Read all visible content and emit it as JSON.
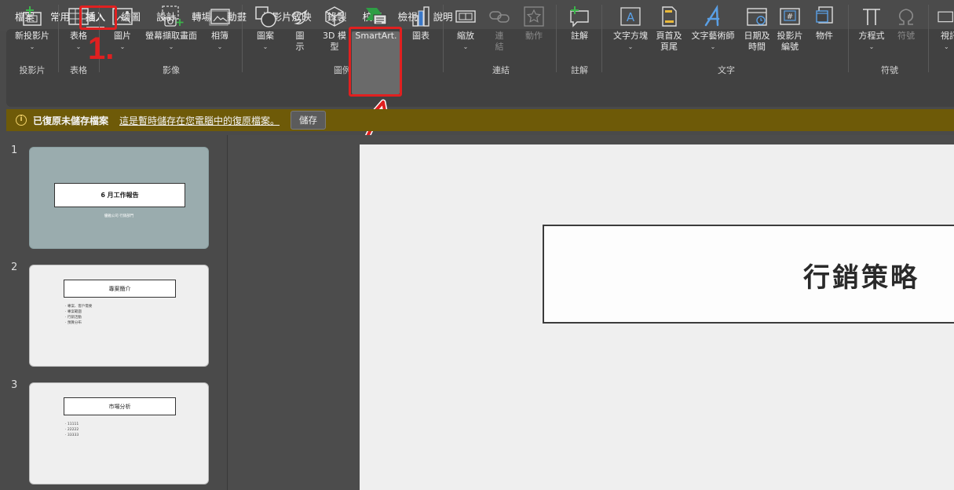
{
  "tabs": [
    "檔案",
    "常用",
    "插入",
    "繪圖",
    "設計",
    "轉場",
    "動畫",
    "投影片放映",
    "錄製",
    "校閱",
    "檢視",
    "說明"
  ],
  "active_tab": "插入",
  "ribbon": {
    "new_slide": "新投影片",
    "table": "表格",
    "pictures": "圖片",
    "screenshot": "螢幕擷取畫面",
    "album": "相簿",
    "shapes": "圖案",
    "icons": "圖示",
    "models3d": "3D 模型",
    "smartart": "SmartArt.",
    "chart": "圖表",
    "zoom": "縮放",
    "link": "連結",
    "action": "動作",
    "comment": "註解",
    "textbox": "文字方塊",
    "header_footer": "頁首及頁尾",
    "wordart": "文字藝術師",
    "datetime": "日期及時間",
    "slide_number": "投影片編號",
    "object": "物件",
    "equation": "方程式",
    "symbol": "符號",
    "video_partial": "視訊"
  },
  "groups": {
    "slides": "投影片",
    "tables": "表格",
    "images": "影像",
    "illustrations": "圖例",
    "links": "連結",
    "comments": "註解",
    "text": "文字",
    "symbols": "符號"
  },
  "annotation_step": "1.",
  "notification": {
    "message": "已復原未儲存檔案",
    "link": "這是暫時儲存在您電腦中的復原檔案。",
    "button": "儲存"
  },
  "slides": [
    {
      "number": "1",
      "title": "6 月工作報告",
      "subtitle": "優雅公司 行銷部門"
    },
    {
      "number": "2",
      "title": "專案簡介",
      "bullets": [
        "· 專案、客戶需要",
        "· 專案範圍",
        "· 行銷活動",
        "· 預算分布"
      ]
    },
    {
      "number": "3",
      "title": "市場分析",
      "bullets": [
        "· 11111",
        "· 22222",
        "· 33333"
      ]
    }
  ],
  "current_slide_title": "行銷策略"
}
